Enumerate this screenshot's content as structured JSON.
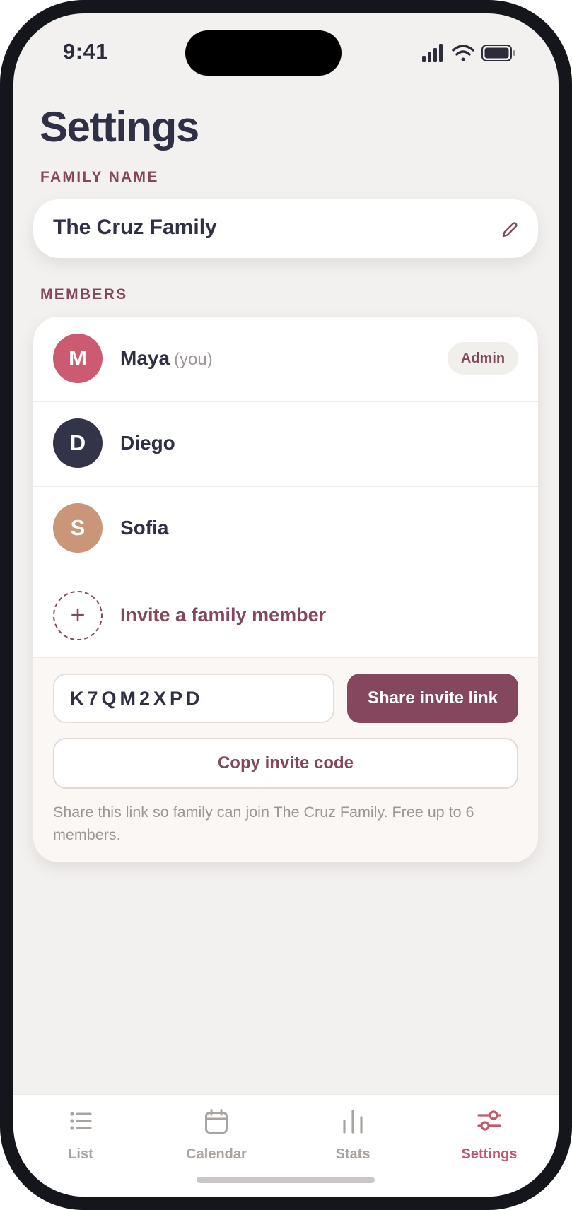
{
  "status_bar": {
    "time": "9:41"
  },
  "page": {
    "title": "Settings"
  },
  "family": {
    "section_label": "FAMILY NAME",
    "name": "The Cruz Family"
  },
  "members": {
    "section_label": "MEMBERS",
    "list": [
      {
        "initial": "M",
        "name": "Maya",
        "suffix": "(you)",
        "badge": "Admin",
        "color": "#cc5b71"
      },
      {
        "initial": "D",
        "name": "Diego",
        "color": "#33344a"
      },
      {
        "initial": "S",
        "name": "Sofia",
        "color": "#c9967a"
      }
    ],
    "invite_label": "Invite a family member"
  },
  "invite": {
    "code": "K7QM2XPD",
    "share_label": "Share invite link",
    "copy_label": "Copy invite code",
    "help_text": "Share this link so family can join The Cruz Family. Free up to 6 members."
  },
  "tabs": [
    {
      "label": "List",
      "icon": "list-icon",
      "active": false
    },
    {
      "label": "Calendar",
      "icon": "calendar-icon",
      "active": false
    },
    {
      "label": "Stats",
      "icon": "stats-icon",
      "active": false
    },
    {
      "label": "Settings",
      "icon": "sliders-icon",
      "active": true
    }
  ],
  "colors": {
    "accent": "#84475d",
    "active_tab": "#c4566e",
    "background": "#f3f1ef",
    "title": "#2f2f45"
  }
}
